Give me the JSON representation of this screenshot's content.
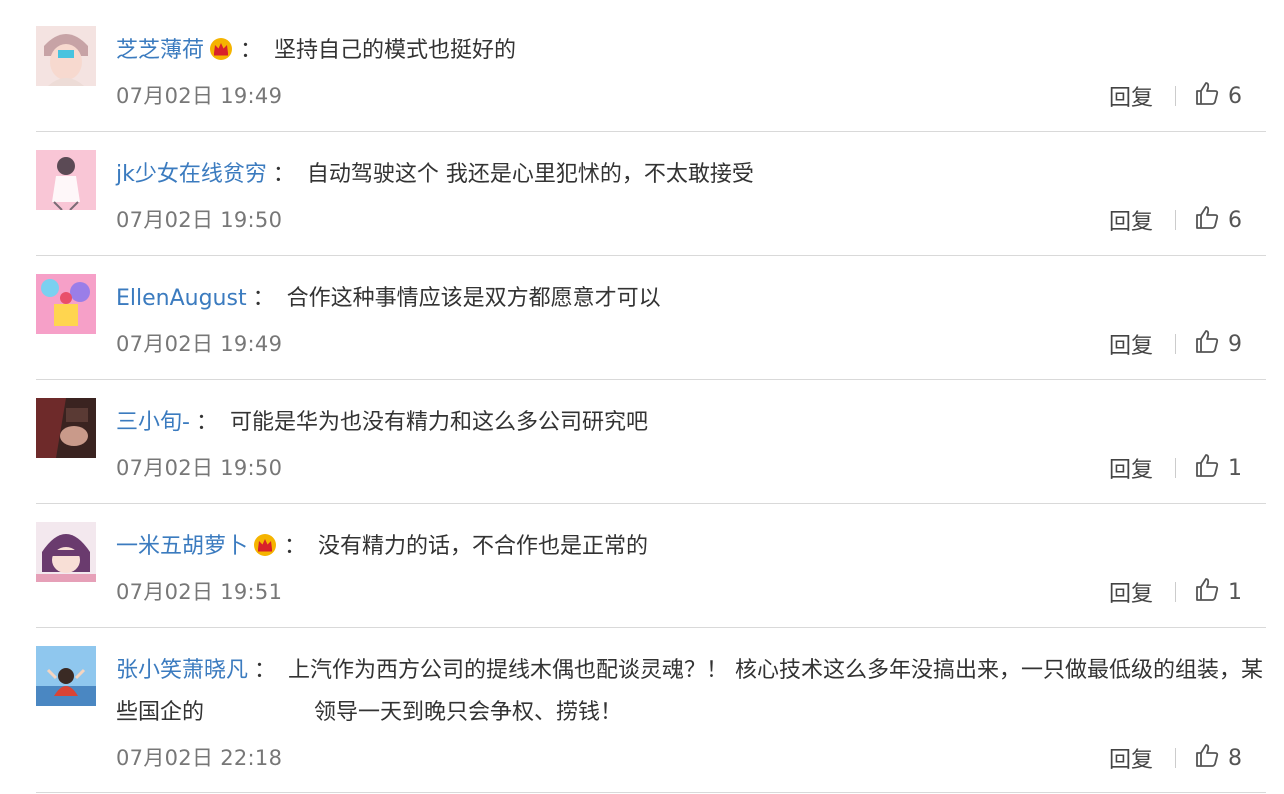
{
  "comments": [
    {
      "username": "芝芝薄荷",
      "vip": true,
      "colon": "：",
      "text": "坚持自己的模式也挺好的",
      "time": "07月02日 19:49",
      "reply_label": "回复",
      "likes": "6",
      "avatar": "avatar-anime-boy"
    },
    {
      "username": "jk少女在线贫穷",
      "vip": false,
      "colon": "：",
      "text": "自动驾驶这个 我还是心里犯怵的，不太敢接受",
      "time": "07月02日 19:50",
      "reply_label": "回复",
      "likes": "6",
      "avatar": "avatar-pink-girl"
    },
    {
      "username": "EllenAugust",
      "vip": false,
      "colon": "：",
      "text": "合作这种事情应该是双方都愿意才可以",
      "time": "07月02日 19:49",
      "reply_label": "回复",
      "likes": "9",
      "avatar": "avatar-colorful-art"
    },
    {
      "username": "三小旬-",
      "vip": false,
      "colon": "：",
      "text": "可能是华为也没有精力和这么多公司研究吧",
      "time": "07月02日 19:50",
      "reply_label": "回复",
      "likes": "1",
      "avatar": "avatar-dark-photo"
    },
    {
      "username": "一米五胡萝卜",
      "vip": true,
      "colon": "：",
      "text": "没有精力的话，不合作也是正常的",
      "time": "07月02日 19:51",
      "reply_label": "回复",
      "likes": "1",
      "avatar": "avatar-purple-hair"
    },
    {
      "username": "张小笑萧晓凡",
      "vip": false,
      "colon": "：",
      "text": "上汽作为西方公司的提线木偶也配谈灵魂？！ 核心技术这么多年没搞出来，一只做最低级的组装，某些国企的　　　　　领导一天到晚只会争权、捞钱！",
      "time": "07月02日 22:18",
      "reply_label": "回复",
      "likes": "8",
      "avatar": "avatar-sky-photo"
    }
  ],
  "colors": {
    "username": "#3b7bbf",
    "text": "#333333",
    "meta": "#777777",
    "divider": "#d9d9d9",
    "vip_crown": "#f5b400"
  }
}
